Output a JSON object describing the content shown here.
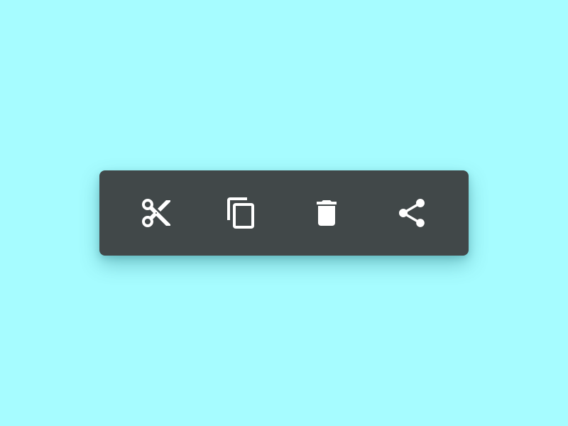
{
  "toolbar": {
    "buttons": [
      {
        "icon": "scissors-icon",
        "action": "cut"
      },
      {
        "icon": "copy-icon",
        "action": "copy"
      },
      {
        "icon": "trash-icon",
        "action": "delete"
      },
      {
        "icon": "share-icon",
        "action": "share"
      }
    ]
  },
  "colors": {
    "background": "#a6fcff",
    "toolbar": "#414849",
    "icon": "#ffffff"
  }
}
